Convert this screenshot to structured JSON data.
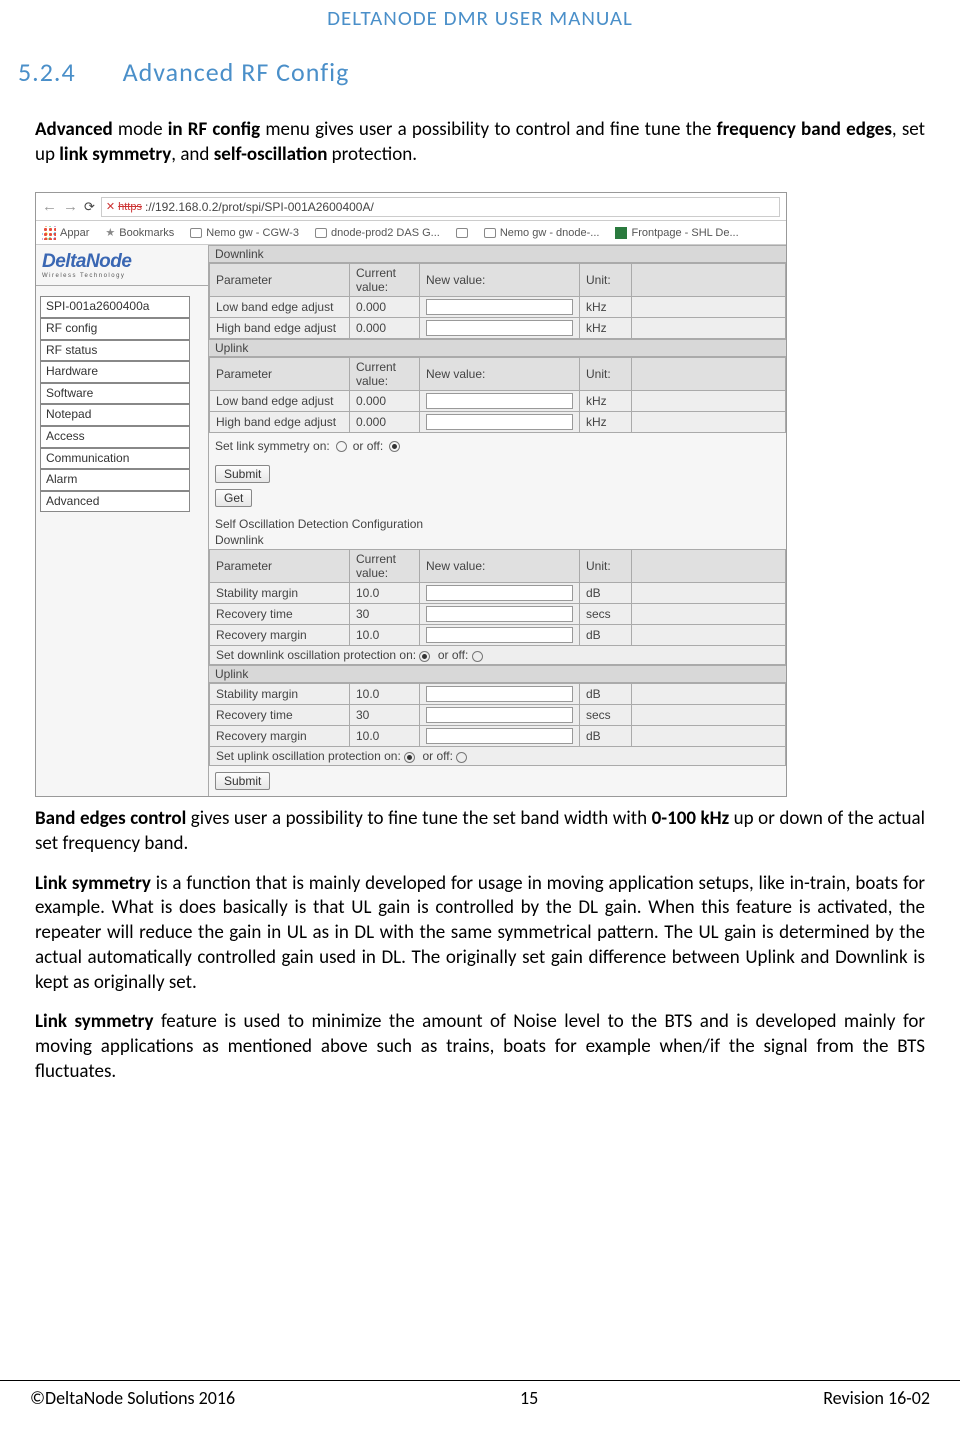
{
  "header": "DELTANODE DMR USER MANUAL",
  "section": {
    "num": "5.2.4",
    "title": "Advanced RF Config"
  },
  "intro": {
    "p1a": "Advanced",
    "p1b": " mode ",
    "p1c": "in RF config",
    "p1d": " menu gives user a possibility to control and fine tune the ",
    "p1e": "frequency band edges",
    "p1f": ", set up ",
    "p1g": "link symmetry",
    "p1h": ", and ",
    "p1i": "self-oscillation",
    "p1j": " protection."
  },
  "browser": {
    "url": "://192.168.0.2/prot/spi/SPI-001A2600400A/",
    "https": "https",
    "bookmarks": {
      "apps": "Appar",
      "bm": "Bookmarks",
      "b1": "Nemo gw - CGW-3",
      "b2": "dnode-prod2 DAS G...",
      "b3": "Nemo gw - dnode-...",
      "b4": "Frontpage - SHL De..."
    }
  },
  "brand": {
    "name": "DeltaNode",
    "sub": "Wireless   Technology"
  },
  "sidebar": [
    "SPI-001a2600400a",
    "RF config",
    "RF status",
    "Hardware",
    "Software",
    "Notepad",
    "Access",
    "Communication",
    "Alarm",
    "Advanced"
  ],
  "tables": {
    "cols": {
      "param": "Parameter",
      "cur": "Current value:",
      "new": "New value:",
      "unit": "Unit:"
    },
    "downlink": "Downlink",
    "uplink": "Uplink",
    "band_low": "Low band edge adjust",
    "band_high": "High band edge adjust",
    "val_zero": "0.000",
    "khz": "kHz",
    "sod_title": "Self Oscillation Detection Configuration",
    "stab": "Stability margin",
    "rect": "Recovery time",
    "recm": "Recovery margin",
    "v10": "10.0",
    "v30": "30",
    "db": "dB",
    "secs": "secs"
  },
  "forms": {
    "link_sym": "Set link symmetry on:",
    "or_off": "or off:",
    "dl_prot": "Set downlink oscillation protection on:",
    "ul_prot": "Set uplink oscillation protection on:",
    "submit": "Submit",
    "get": "Get"
  },
  "body": {
    "p2a": "Band edges control",
    "p2b": " gives user a possibility to fine tune the set band width with ",
    "p2c": "0-100 kHz",
    "p2d": " up or down of the actual set frequency band.",
    "p3a": "Link symmetry",
    "p3b": " is a function that is mainly developed for usage in moving application setups, like in-train, boats for example. What is does basically is that UL gain is controlled by the DL gain. When this feature is activated, the repeater will reduce the gain in UL as in DL with the same symmetrical pattern. The UL gain is determined by the actual automatically controlled gain used in DL. The originally set gain difference between Uplink and Downlink is kept as originally set.",
    "p4a": "Link symmetry",
    "p4b": " feature is used to minimize the amount of Noise level to the BTS and is developed mainly for moving applications as mentioned above such as trains, boats for example when/if the signal from the BTS fluctuates."
  },
  "footer": {
    "left": "©DeltaNode Solutions 2016",
    "center": "15",
    "right": "Revision 16-02"
  }
}
